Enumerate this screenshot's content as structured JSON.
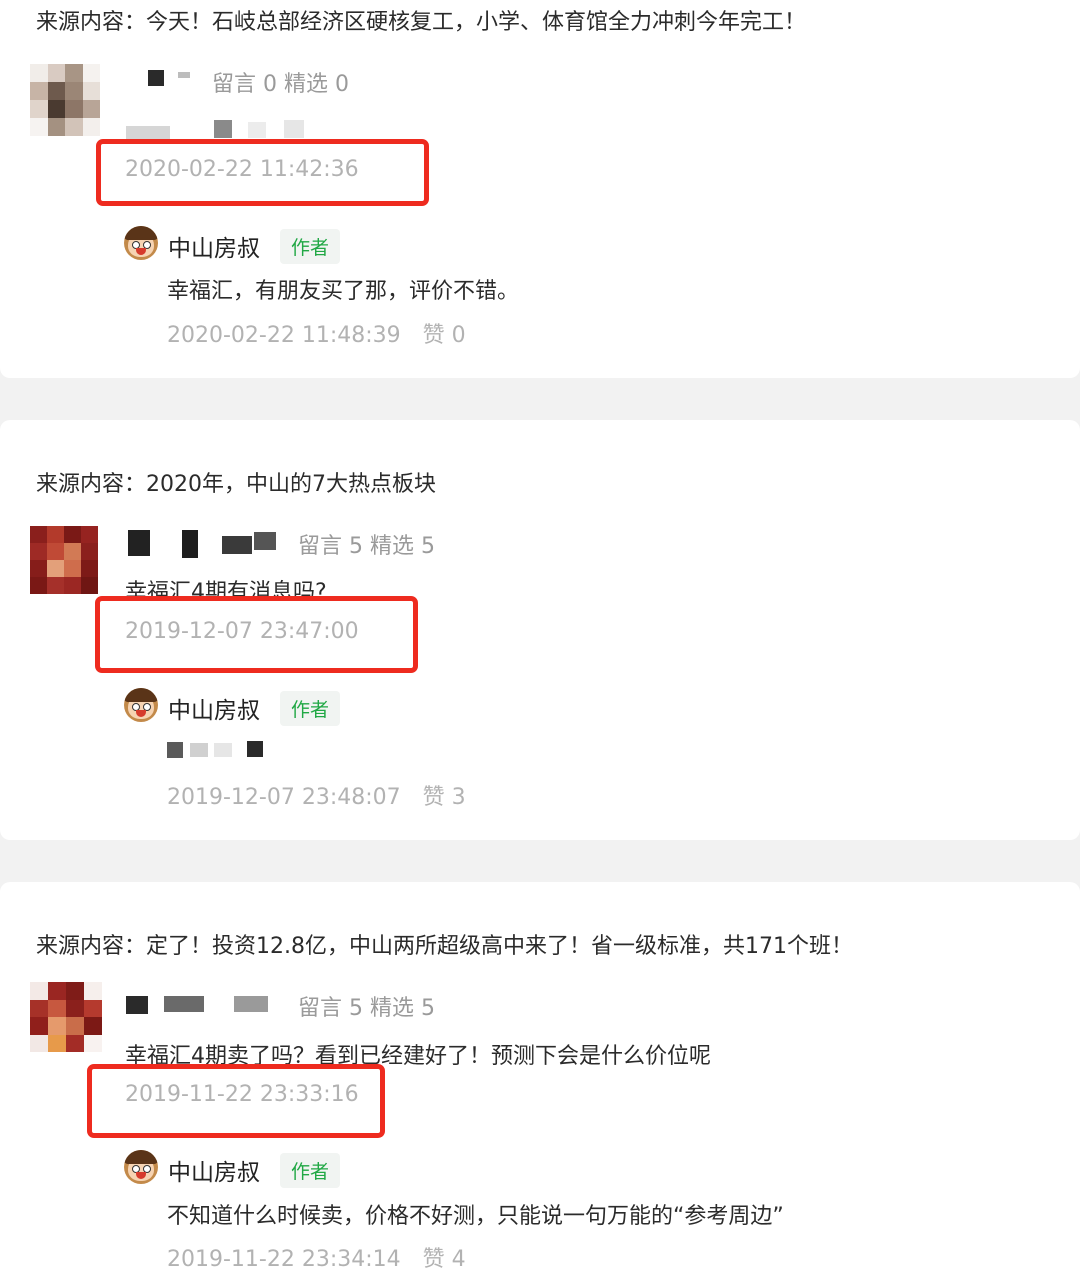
{
  "posts": [
    {
      "source_prefix": "来源内容：",
      "source_title": "今天！石岐总部经济区硬核复工，小学、体育馆全力冲刺今年完工！",
      "commenter": {
        "stats": "留言 0   精选 0",
        "comment_text": "",
        "time": "2020-02-22 11:42:36"
      },
      "reply": {
        "author": "中山房叔",
        "badge": "作者",
        "text": "幸福汇，有朋友买了那，评价不错。",
        "time": "2020-02-22 11:48:39",
        "likes": "赞 0"
      }
    },
    {
      "source_prefix": "来源内容：",
      "source_title": "2020年，中山的7大热点板块",
      "commenter": {
        "stats": "留言 5   精选 5",
        "comment_text": "幸福汇4期有消息吗?",
        "time": "2019-12-07 23:47:00"
      },
      "reply": {
        "author": "中山房叔",
        "badge": "作者",
        "text": "",
        "time": "2019-12-07 23:48:07",
        "likes": "赞 3"
      }
    },
    {
      "source_prefix": "来源内容：",
      "source_title": "定了！投资12.8亿，中山两所超级高中来了！省一级标准，共171个班！",
      "commenter": {
        "stats": "留言 5   精选 5",
        "comment_text": "幸福汇4期卖了吗？看到已经建好了！预测下会是什么价位呢",
        "time": "2019-11-22 23:33:16"
      },
      "reply": {
        "author": "中山房叔",
        "badge": "作者",
        "text": "不知道什么时候卖，价格不好测，只能说一句万能的“参考周边”",
        "time": "2019-11-22 23:34:14",
        "likes": "赞 4"
      }
    }
  ],
  "colors": {
    "highlight": "#ee2b1f",
    "author_badge": "#21a845",
    "page_background": "#f2f2f2"
  }
}
